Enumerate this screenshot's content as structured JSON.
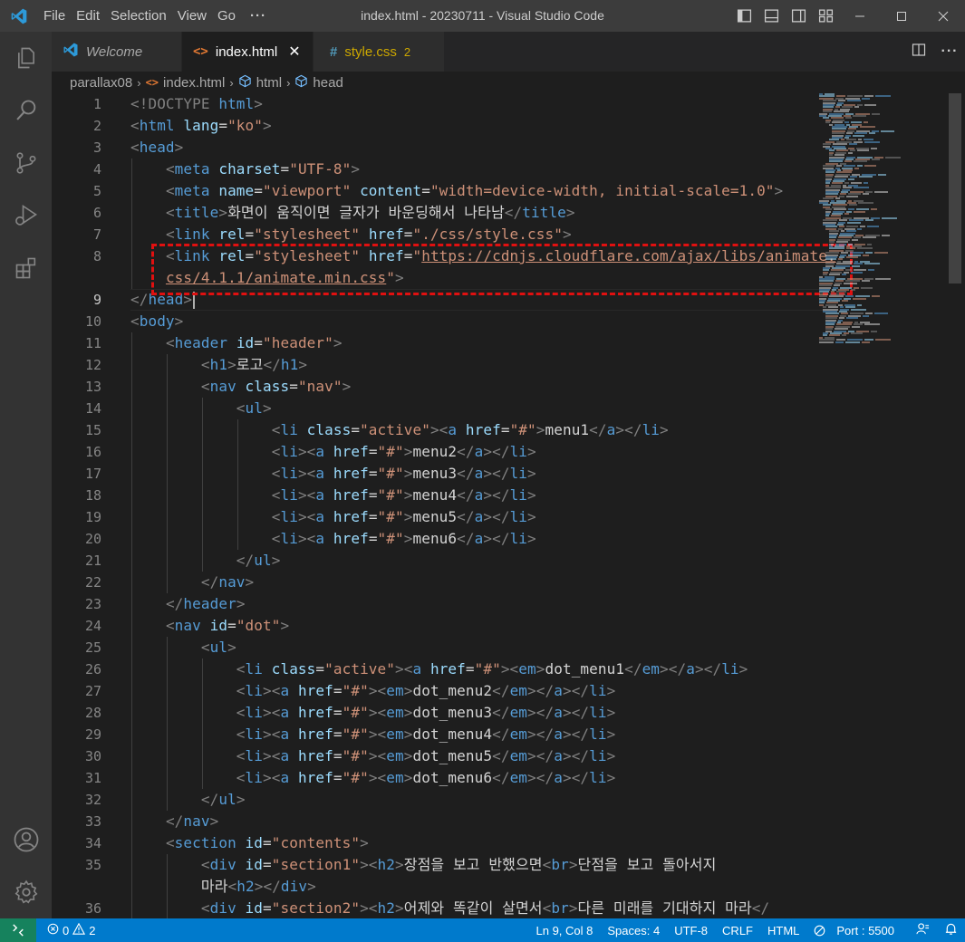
{
  "titlebar": {
    "menu": [
      "File",
      "Edit",
      "Selection",
      "View",
      "Go"
    ],
    "more": "···",
    "window_title": "index.html - 20230711 - Visual Studio Code"
  },
  "activity_bar": [
    "explorer-icon",
    "search-icon",
    "source-control-icon",
    "run-debug-icon",
    "extensions-icon",
    "accounts-icon",
    "manage-gear-icon"
  ],
  "tabs": [
    {
      "label": "Welcome",
      "icon": "vscode-icon"
    },
    {
      "label": "index.html",
      "icon": "html-icon",
      "active": true
    },
    {
      "label": "style.css",
      "icon": "css-icon",
      "badge": "2"
    }
  ],
  "breadcrumb": [
    "parallax08",
    "index.html",
    "html",
    "head"
  ],
  "editor": {
    "current_line": "9",
    "line_numbers": [
      "1",
      "2",
      "3",
      "4",
      "5",
      "6",
      "7",
      "8",
      "9",
      "10",
      "11",
      "12",
      "13",
      "14",
      "15",
      "16",
      "17",
      "18",
      "19",
      "20",
      "21",
      "22",
      "23",
      "24",
      "25",
      "26",
      "27",
      "28",
      "29",
      "30",
      "31",
      "32",
      "33",
      "34",
      "35",
      "36"
    ]
  },
  "code": {
    "l1_doctype": "<!DOCTYPE",
    "l1_html": " html",
    "l1_close": ">",
    "l6_text": "화면이 움직이면 글자가 바운딩해서 나타남",
    "l8_url1": "https://cdnjs.cloudflare.com/ajax/libs/animate.",
    "l8_url2": "css/4.1.1/animate.min.css",
    "l12_text": "로고",
    "menu_items": [
      "menu1",
      "menu2",
      "menu3",
      "menu4",
      "menu5",
      "menu6"
    ],
    "dot_items": [
      "dot_menu1",
      "dot_menu2",
      "dot_menu3",
      "dot_menu4",
      "dot_menu5",
      "dot_menu6"
    ],
    "l35_text1": "장점을 보고 반했으면",
    "l35_text2": "단점을 보고 돌아서지",
    "l35_text3": "마라",
    "l36_text1": "어제와 똑같이 살면서",
    "l36_text2": "다른 미래를 기대하지 마라"
  },
  "statusbar": {
    "errors": "0",
    "warnings": "2",
    "position": "Ln 9, Col 8",
    "spaces": "Spaces: 4",
    "encoding": "UTF-8",
    "eol": "CRLF",
    "language": "HTML",
    "port": "Port : 5500"
  },
  "colors": {
    "accent": "#007acc",
    "annotation_box": "#e01010"
  }
}
